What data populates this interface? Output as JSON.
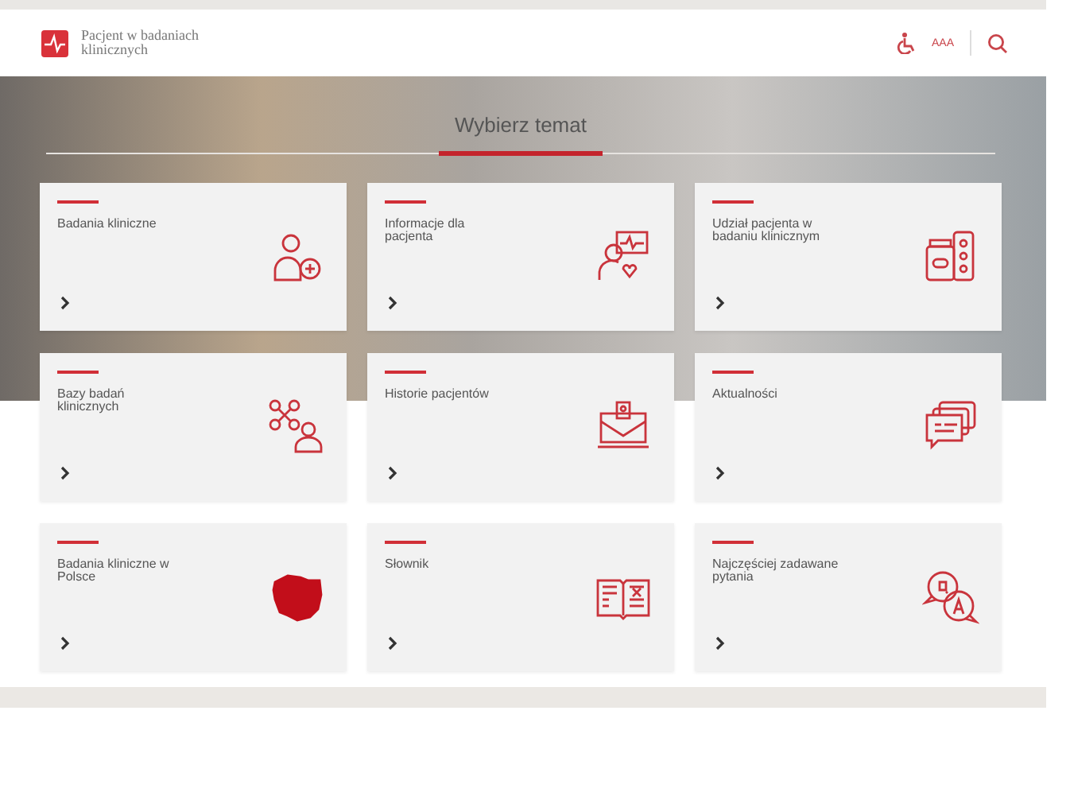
{
  "header": {
    "logo_text": "Pacjent w badaniach klinicznych",
    "font_size_button": "AAA"
  },
  "section": {
    "title": "Wybierz temat"
  },
  "cards": [
    {
      "title": "Badania kliniczne"
    },
    {
      "title": "Informacje dla pacjenta"
    },
    {
      "title": "Udział pacjenta w badaniu klinicznym"
    },
    {
      "title": "Bazy badań klinicznych"
    },
    {
      "title": "Historie pacjentów"
    },
    {
      "title": "Aktualności"
    },
    {
      "title": "Badania kliniczne w Polsce"
    },
    {
      "title": "Słownik"
    },
    {
      "title": "Najczęściej zadawane pytania"
    }
  ]
}
